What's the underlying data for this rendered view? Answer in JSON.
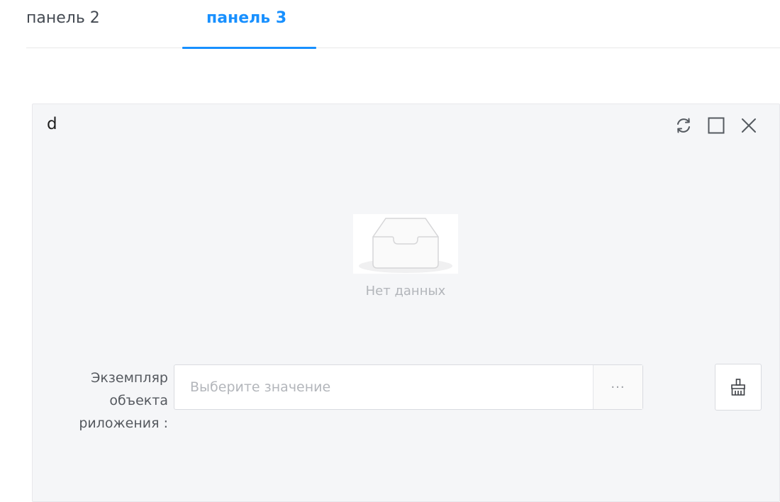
{
  "tabs": [
    {
      "label": "панель 2",
      "active": false
    },
    {
      "label": "панель 3",
      "active": true
    }
  ],
  "colors": {
    "accent": "#1890ff",
    "panel_bg": "#f5f6f8",
    "text": "#444a52",
    "placeholder": "#b3b6bb"
  },
  "panel": {
    "title": "d",
    "actions": [
      "refresh-icon",
      "maximize-icon",
      "close-icon"
    ],
    "empty_state": {
      "icon": "empty-inbox-icon",
      "text": "Нет данных"
    },
    "field": {
      "label_lines": [
        "Экземпляр",
        "объекта",
        "риложения :"
      ],
      "placeholder": "Выберите значение",
      "value": "",
      "more_label": "···",
      "clear_icon": "broom-icon"
    }
  }
}
